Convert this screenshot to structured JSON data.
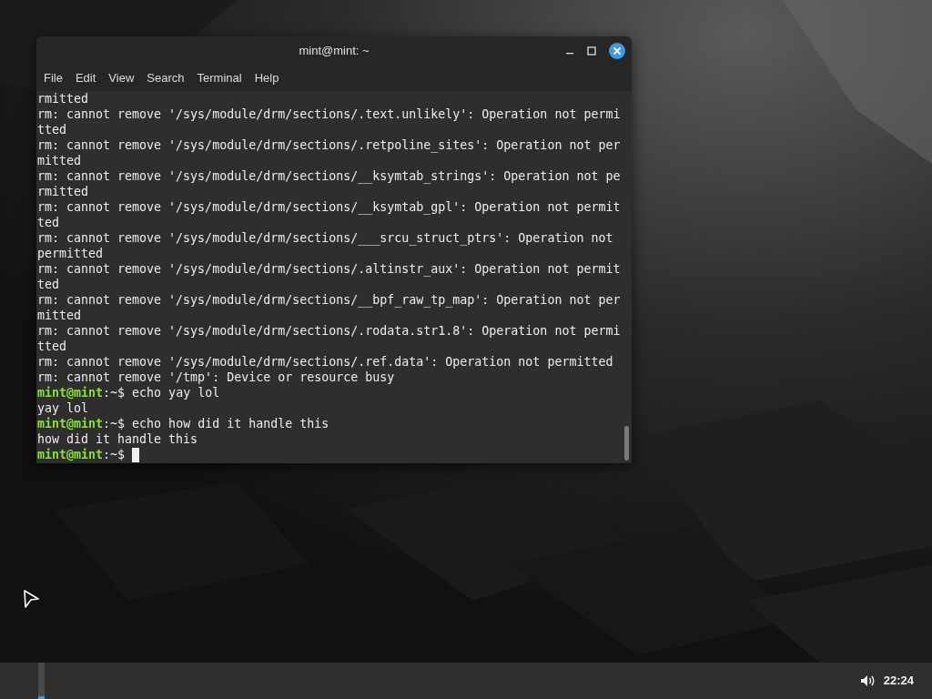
{
  "window": {
    "title": "mint@mint: ~",
    "menu": [
      "File",
      "Edit",
      "View",
      "Search",
      "Terminal",
      "Help"
    ]
  },
  "terminal": {
    "lines": [
      {
        "kind": "output",
        "text": "rmitted"
      },
      {
        "kind": "output",
        "text": "rm: cannot remove '/sys/module/drm/sections/.text.unlikely': Operation not permi"
      },
      {
        "kind": "output",
        "text": "tted"
      },
      {
        "kind": "output",
        "text": "rm: cannot remove '/sys/module/drm/sections/.retpoline_sites': Operation not per"
      },
      {
        "kind": "output",
        "text": "mitted"
      },
      {
        "kind": "output",
        "text": "rm: cannot remove '/sys/module/drm/sections/__ksymtab_strings': Operation not pe"
      },
      {
        "kind": "output",
        "text": "rmitted"
      },
      {
        "kind": "output",
        "text": "rm: cannot remove '/sys/module/drm/sections/__ksymtab_gpl': Operation not permit"
      },
      {
        "kind": "output",
        "text": "ted"
      },
      {
        "kind": "output",
        "text": "rm: cannot remove '/sys/module/drm/sections/___srcu_struct_ptrs': Operation not"
      },
      {
        "kind": "output",
        "text": "permitted"
      },
      {
        "kind": "output",
        "text": "rm: cannot remove '/sys/module/drm/sections/.altinstr_aux': Operation not permit"
      },
      {
        "kind": "output",
        "text": "ted"
      },
      {
        "kind": "output",
        "text": "rm: cannot remove '/sys/module/drm/sections/__bpf_raw_tp_map': Operation not per"
      },
      {
        "kind": "output",
        "text": "mitted"
      },
      {
        "kind": "output",
        "text": "rm: cannot remove '/sys/module/drm/sections/.rodata.str1.8': Operation not permi"
      },
      {
        "kind": "output",
        "text": "tted"
      },
      {
        "kind": "output",
        "text": "rm: cannot remove '/sys/module/drm/sections/.ref.data': Operation not permitted"
      },
      {
        "kind": "output",
        "text": "rm: cannot remove '/tmp': Device or resource busy"
      },
      {
        "kind": "prompt",
        "user": "mint@mint",
        "path": ":~$",
        "command": "echo yay lol",
        "cursor": false
      },
      {
        "kind": "output",
        "text": "yay lol"
      },
      {
        "kind": "prompt",
        "user": "mint@mint",
        "path": ":~$",
        "command": "echo how did it handle this",
        "cursor": false
      },
      {
        "kind": "output",
        "text": "how did it handle this"
      },
      {
        "kind": "prompt",
        "user": "mint@mint",
        "path": ":~$",
        "cursor": true
      }
    ]
  },
  "panel": {
    "clock": "22:24"
  }
}
